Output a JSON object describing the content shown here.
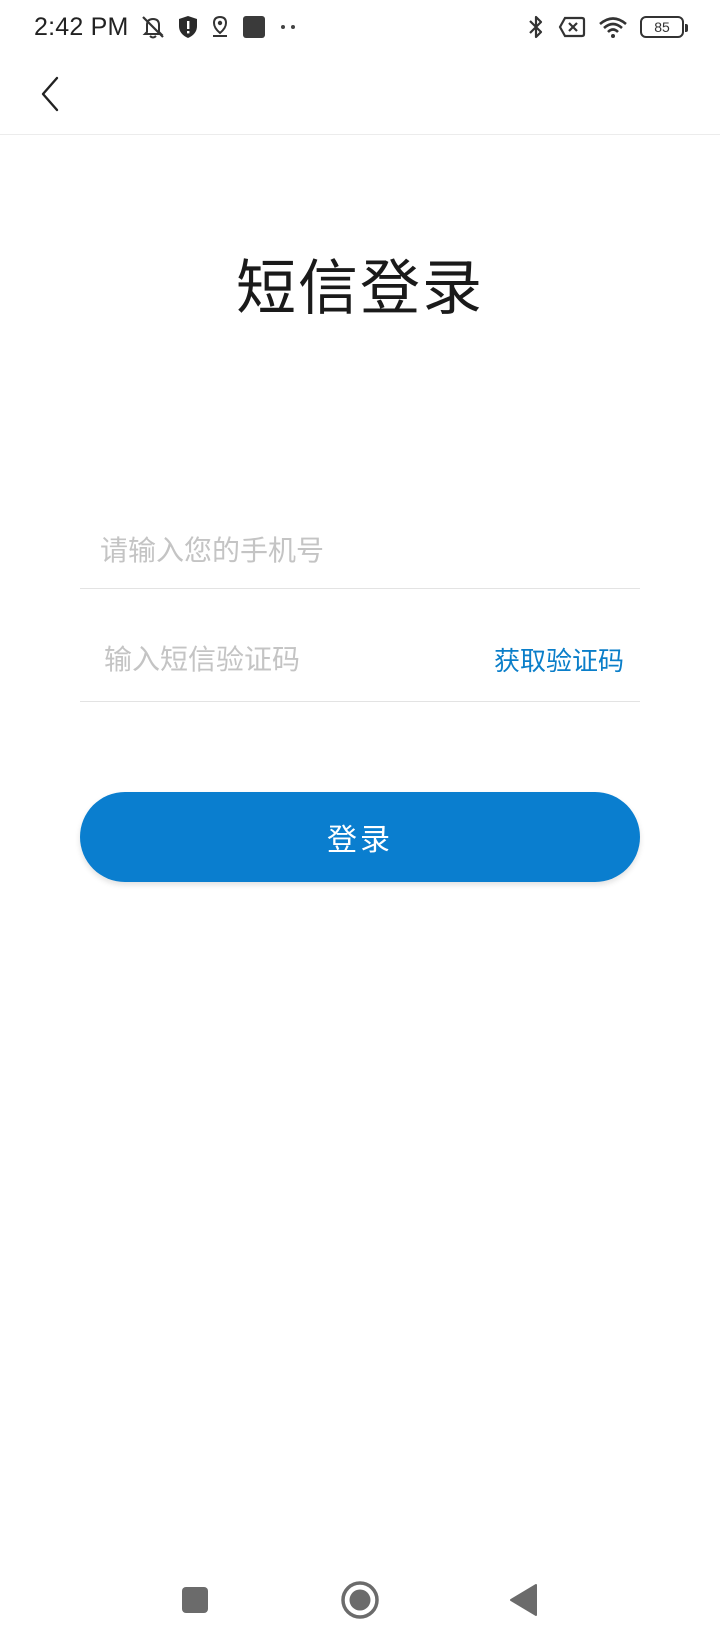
{
  "status_bar": {
    "time": "2:42 PM",
    "icons": [
      "mute-icon",
      "shield-icon",
      "location-icon",
      "app-square-icon",
      "more-dots-icon",
      "bluetooth-icon",
      "sim-off-icon",
      "wifi-icon"
    ],
    "battery_level": "85"
  },
  "app_bar": {
    "back_icon": "chevron-left-icon"
  },
  "page": {
    "title": "短信登录"
  },
  "form": {
    "phone_placeholder": "请输入您的手机号",
    "phone_value": "",
    "code_placeholder": "输入短信验证码",
    "code_value": "",
    "get_code_label": "获取验证码",
    "login_label": "登录"
  },
  "colors": {
    "accent": "#0a7ecf",
    "link": "#0a7ec9",
    "placeholder": "#c4c4c4"
  },
  "nav_bar": {
    "buttons": [
      "recents-square-icon",
      "home-circle-icon",
      "back-triangle-icon"
    ]
  }
}
